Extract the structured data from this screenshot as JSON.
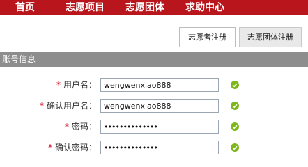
{
  "nav": {
    "items": [
      "首页",
      "志愿项目",
      "志愿团体",
      "求助中心"
    ]
  },
  "tabs": {
    "volunteer": "志愿者注册",
    "group": "志愿团体注册"
  },
  "section": {
    "title": "账号信息"
  },
  "form": {
    "required_mark": "*",
    "username": {
      "label": "用户名：",
      "value": "wengwenxiao888"
    },
    "confirm_username": {
      "label": "确认用户名：",
      "value": "wengwenxiao888"
    },
    "password": {
      "label": "密码：",
      "value": "••••••••••••••"
    },
    "confirm_password": {
      "label": "确认密码：",
      "value": "••••••••••••••"
    }
  },
  "colors": {
    "nav_bg": "#b8161c",
    "section_bg": "#8d8d8d",
    "check": "#7cb81a",
    "required": "#d0021b"
  },
  "icons": {
    "valid": "check-icon"
  }
}
